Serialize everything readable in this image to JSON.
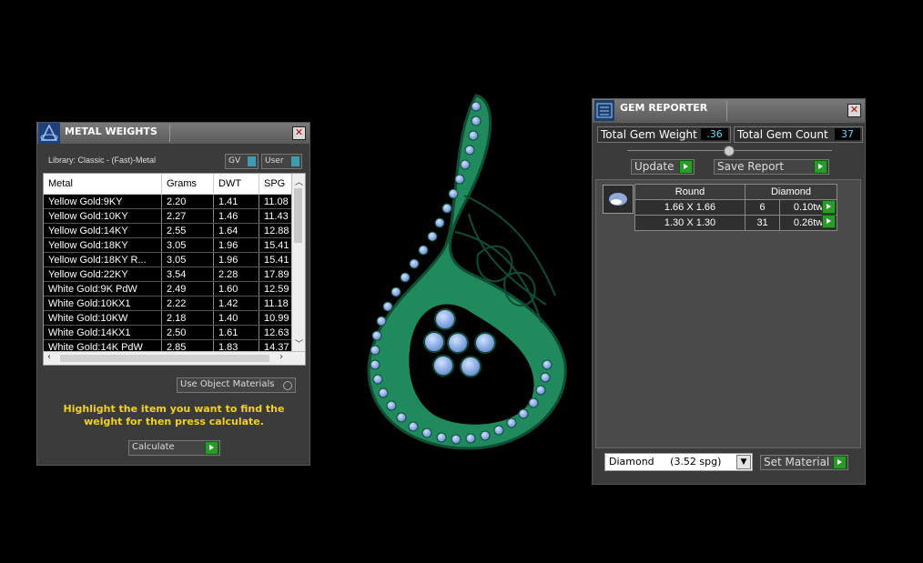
{
  "metal_weights": {
    "title": "METAL WEIGHTS",
    "library_label": "Library: Classic - (Fast)-Metal",
    "gv_label": "GV",
    "user_label": "User",
    "columns": [
      "Metal",
      "Grams",
      "DWT",
      "SPG"
    ],
    "rows": [
      {
        "metal": "Yellow Gold:9KY",
        "grams": "2.20",
        "dwt": "1.41",
        "spg": "11.08"
      },
      {
        "metal": "Yellow Gold:10KY",
        "grams": "2.27",
        "dwt": "1.46",
        "spg": "11.43"
      },
      {
        "metal": "Yellow Gold:14KY",
        "grams": "2.55",
        "dwt": "1.64",
        "spg": "12.88"
      },
      {
        "metal": "Yellow Gold:18KY",
        "grams": "3.05",
        "dwt": "1.96",
        "spg": "15.41"
      },
      {
        "metal": "Yellow Gold:18KY R...",
        "grams": "3.05",
        "dwt": "1.96",
        "spg": "15.41"
      },
      {
        "metal": "Yellow Gold:22KY",
        "grams": "3.54",
        "dwt": "2.28",
        "spg": "17.89"
      },
      {
        "metal": "White Gold:9K PdW",
        "grams": "2.49",
        "dwt": "1.60",
        "spg": "12.59"
      },
      {
        "metal": "White Gold:10KX1",
        "grams": "2.22",
        "dwt": "1.42",
        "spg": "11.18"
      },
      {
        "metal": "White Gold:10KW",
        "grams": "2.18",
        "dwt": "1.40",
        "spg": "10.99"
      },
      {
        "metal": "White Gold:14KX1",
        "grams": "2.50",
        "dwt": "1.61",
        "spg": "12.63"
      },
      {
        "metal": "White Gold:14K PdW",
        "grams": "2.85",
        "dwt": "1.83",
        "spg": "14.37"
      }
    ],
    "use_object_materials_label": "Use Object Materials",
    "instruction": "Highlight the item you want to find the weight for then press calculate.",
    "calculate_label": "Calculate"
  },
  "gem_reporter": {
    "title": "GEM REPORTER",
    "total_gem_weight_label": "Total Gem Weight",
    "total_gem_weight_value": ".36",
    "total_gem_count_label": "Total Gem Count",
    "total_gem_count_value": "37",
    "update_label": "Update",
    "save_report_label": "Save Report",
    "shape_header": "Round",
    "material_header": "Diamond",
    "gems": [
      {
        "size": "1.66 X 1.66",
        "count": "6",
        "weight": "0.10tw"
      },
      {
        "size": "1.30 X 1.30",
        "count": "31",
        "weight": "0.26tw"
      }
    ],
    "material_select_value": "Diamond     (3.52 spg)",
    "set_material_label": "Set Material"
  },
  "colors": {
    "highlight_text": "#f2d21a",
    "metal_green": "#1f8a5c",
    "gem_blue": "#8fb4e8",
    "button_green": "#2a9a2a"
  }
}
